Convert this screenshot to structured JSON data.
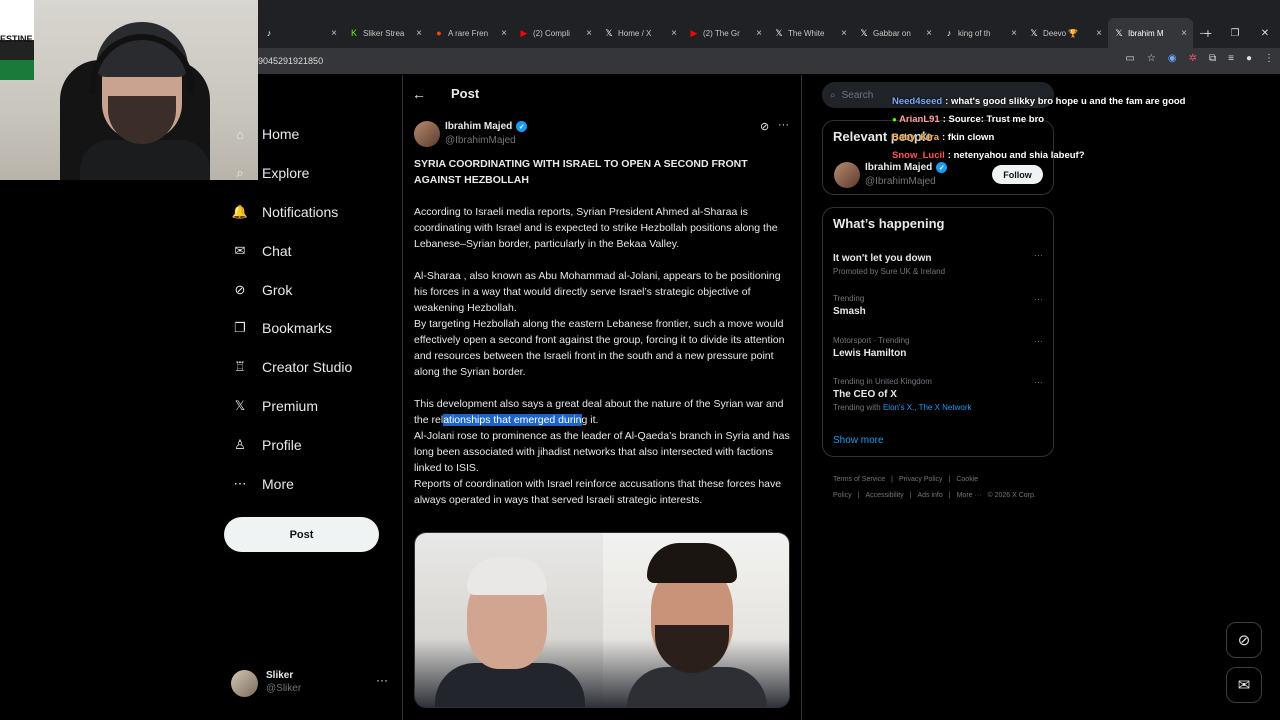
{
  "browser": {
    "tabs": [
      {
        "icon": "tiktok-icon",
        "glyph": "♪",
        "label": "",
        "color": "#ffffff"
      },
      {
        "icon": "kick-icon",
        "glyph": "K",
        "label": "Sliker Strea",
        "color": "#53fc18"
      },
      {
        "icon": "reddit-icon",
        "glyph": "●",
        "label": "A rare Fren",
        "color": "#ff4500"
      },
      {
        "icon": "youtube-icon",
        "glyph": "▶",
        "label": "(2) Compli",
        "color": "#ff0000"
      },
      {
        "icon": "x-icon",
        "glyph": "𝕏",
        "label": "Home / X",
        "color": "#ffffff"
      },
      {
        "icon": "youtube-icon",
        "glyph": "▶",
        "label": "(2) The Gr",
        "color": "#ff0000"
      },
      {
        "icon": "x-icon",
        "glyph": "𝕏",
        "label": "The White",
        "color": "#ffffff"
      },
      {
        "icon": "x-icon",
        "glyph": "𝕏",
        "label": "Gabbar on",
        "color": "#ffffff"
      },
      {
        "icon": "tiktok-icon",
        "glyph": "♪",
        "label": "king of th",
        "color": "#ffffff"
      },
      {
        "icon": "x-icon",
        "glyph": "𝕏",
        "label": "Deevo 🏆",
        "color": "#ffffff"
      },
      {
        "icon": "x-icon",
        "glyph": "𝕏",
        "label": "Ibrahim M",
        "color": "#ffffff",
        "active": true
      }
    ],
    "url": "9045291921850",
    "flag_text": "ESTINE"
  },
  "nav": {
    "items": [
      {
        "key": "home",
        "label": "Home",
        "icon": "home-icon",
        "glyph": "⌂"
      },
      {
        "key": "explore",
        "label": "Explore",
        "icon": "search-icon",
        "glyph": "⌕"
      },
      {
        "key": "notifications",
        "label": "Notifications",
        "icon": "bell-icon",
        "glyph": "🔔"
      },
      {
        "key": "chat",
        "label": "Chat",
        "icon": "mail-icon",
        "glyph": "✉"
      },
      {
        "key": "grok",
        "label": "Grok",
        "icon": "grok-icon",
        "glyph": "⊘"
      },
      {
        "key": "bookmarks",
        "label": "Bookmarks",
        "icon": "bookmark-icon",
        "glyph": "❐"
      },
      {
        "key": "creator-studio",
        "label": "Creator Studio",
        "icon": "creator-studio-icon",
        "glyph": "♖"
      },
      {
        "key": "premium",
        "label": "Premium",
        "icon": "x-logo-icon",
        "glyph": "𝕏"
      },
      {
        "key": "profile",
        "label": "Profile",
        "icon": "person-icon",
        "glyph": "♙"
      },
      {
        "key": "more",
        "label": "More",
        "icon": "more-circle-icon",
        "glyph": "⋯"
      }
    ],
    "post_button": "Post",
    "account": {
      "name": "Sliker",
      "handle": "@Sliker"
    }
  },
  "main": {
    "title": "Post",
    "author": {
      "name": "Ibrahim Majed",
      "handle": "@IbrahimMajed"
    },
    "headline": "SYRIA COORDINATING WITH ISRAEL TO OPEN A SECOND FRONT AGAINST HEZBOLLAH",
    "p1": "According to Israeli media reports, Syrian President Ahmed al-Sharaa is coordinating with Israel and is expected to strike Hezbollah positions along the Lebanese–Syrian border, particularly in the Bekaa Valley.",
    "p2": "Al-Sharaa , also known as Abu Mohammad al-Jolani, appears to be positioning his forces in a way that would directly serve Israel’s strategic objective of weakening Hezbollah.",
    "p3": "By targeting Hezbollah along the eastern Lebanese frontier, such a move would effectively open a second front against the group, forcing it to divide its attention and resources between the Israeli front in the south and a new pressure point along the Syrian border.",
    "p4_pre": "This development also says a great deal about the nature of the Syrian war and the rel",
    "p4_hl": "ationships that emerged durin",
    "p4_post": "g it.",
    "p5": "Al-Jolani rose to prominence as the leader of Al-Qaeda’s branch in Syria and has long been associated with jihadist networks that also intersected with factions linked to ISIS.",
    "p6": "Reports of coordination with Israel reinforce accusations that these forces have always operated in ways that  served Israeli strategic interests."
  },
  "right": {
    "search_placeholder": "Search",
    "relevant_title": "Relevant people",
    "relevant_person": {
      "name": "Ibrahim Majed",
      "handle": "@IbrahimMajed",
      "follow": "Follow"
    },
    "happening_title": "What’s happening",
    "trends": [
      {
        "context": "",
        "name": "It won't let you down",
        "sub": "Promoted by Sure UK & Ireland",
        "link": ""
      },
      {
        "context": "Trending",
        "name": "Smash",
        "sub": "",
        "link": ""
      },
      {
        "context": "Motorsport · Trending",
        "name": "Lewis Hamilton",
        "sub": "",
        "link": ""
      },
      {
        "context": "Trending in United Kingdom",
        "name": "The CEO of X",
        "sub": "Trending with ",
        "link": "Elon's X., The X Network"
      }
    ],
    "show_more": "Show more",
    "footer": [
      "Terms of Service",
      "|",
      "Privacy Policy",
      "|",
      "Cookie Policy",
      "|",
      "Accessibility",
      "|",
      "Ads info",
      "|",
      "More ···",
      "© 2026 X Corp."
    ]
  },
  "chat": [
    {
      "name": "Need4seed",
      "color": "#7aa7ff",
      "msg": ": what's good slikky bro hope u and the fam are good"
    },
    {
      "name": "ArianL91",
      "color": "#ff9f9f",
      "msg": ": Source: Trust me bro"
    },
    {
      "name": "Baby_Kira",
      "color": "#ffb347",
      "msg": ": fkin clown"
    },
    {
      "name": "Snow_Lucil",
      "color": "#ff5555",
      "msg": ": netenyahou and shia labeuf?"
    }
  ]
}
